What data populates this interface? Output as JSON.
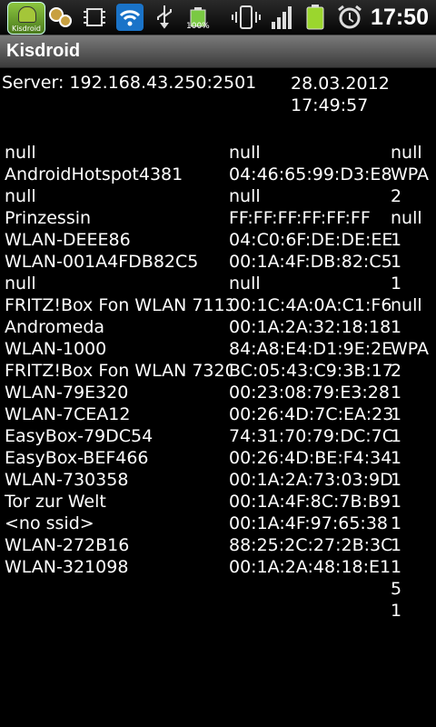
{
  "status_bar": {
    "app_icon_caption": "Kisdroid",
    "battery_percent": "100%",
    "clock": "17:50"
  },
  "title_bar": {
    "title": "Kisdroid"
  },
  "info": {
    "server": "Server: 192.168.43.250:2501",
    "date": "28.03.2012",
    "time": "17:49:57"
  },
  "rows": [
    [
      "null",
      "null",
      "null"
    ],
    [
      "AndroidHotspot4381",
      "04:46:65:99:D3:E8",
      "WPA"
    ],
    [
      "null",
      "null",
      "2"
    ],
    [
      "Prinzessin",
      "FF:FF:FF:FF:FF:FF",
      "null"
    ],
    [
      "WLAN-DEEE86",
      "04:C0:6F:DE:DE:EE",
      "1"
    ],
    [
      "WLAN-001A4FDB82C5",
      "00:1A:4F:DB:82:C5",
      "1"
    ],
    [
      "null",
      "null",
      "1"
    ],
    [
      "FRITZ!Box Fon WLAN 7113",
      "00:1C:4A:0A:C1:F6",
      "null"
    ],
    [
      "Andromeda",
      "00:1A:2A:32:18:18",
      "1"
    ],
    [
      "WLAN-1000",
      "84:A8:E4:D1:9E:2E",
      "WPA"
    ],
    [
      "FRITZ!Box Fon WLAN 7320",
      "BC:05:43:C9:3B:17",
      "2"
    ],
    [
      "WLAN-79E320",
      "00:23:08:79:E3:28",
      "1"
    ],
    [
      "WLAN-7CEA12",
      "00:26:4D:7C:EA:23",
      "1"
    ],
    [
      "EasyBox-79DC54",
      "74:31:70:79:DC:7C",
      "1"
    ],
    [
      "EasyBox-BEF466",
      "00:26:4D:BE:F4:34",
      "1"
    ],
    [
      "WLAN-730358",
      "00:1A:2A:73:03:9D",
      "1"
    ],
    [
      "Tor zur Welt",
      "00:1A:4F:8C:7B:B9",
      "1"
    ],
    [
      "<no ssid>",
      "00:1A:4F:97:65:38",
      "1"
    ],
    [
      "WLAN-272B16",
      "88:25:2C:27:2B:3C",
      "1"
    ],
    [
      "WLAN-321098",
      "00:1A:2A:48:18:E1",
      "1"
    ],
    [
      "",
      "",
      "5"
    ],
    [
      "",
      "",
      "1"
    ]
  ]
}
